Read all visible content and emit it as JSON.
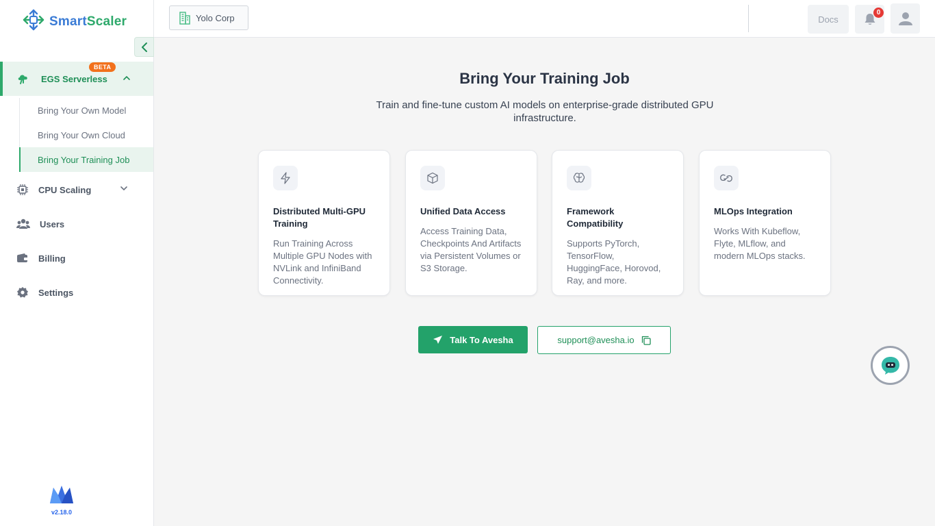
{
  "brand": {
    "name_part1": "Smart",
    "name_part2": "Scaler",
    "primary_color": "#3a7bd5",
    "accent_color": "#2ea96b"
  },
  "sidebar": {
    "egs": {
      "label": "EGS Serverless",
      "badge": "BETA"
    },
    "sub_items": [
      {
        "label": "Bring Your Own Model"
      },
      {
        "label": "Bring Your Own Cloud"
      },
      {
        "label": "Bring Your Training Job",
        "active": true
      }
    ],
    "items": [
      {
        "label": "CPU Scaling",
        "icon": "cpu-icon"
      },
      {
        "label": "Users",
        "icon": "users-icon"
      },
      {
        "label": "Billing",
        "icon": "wallet-icon"
      },
      {
        "label": "Settings",
        "icon": "gear-icon"
      }
    ],
    "version": "v2.18.0"
  },
  "header": {
    "org": "Yolo Corp",
    "docs": "Docs",
    "notification_count": "0"
  },
  "main": {
    "title": "Bring Your Training Job",
    "subtitle": "Train and fine-tune custom AI models on enterprise-grade distributed GPU infrastructure.",
    "cards": [
      {
        "title": "Distributed Multi-GPU Training",
        "desc": "Run Training Across Multiple GPU Nodes with NVLink and InfiniBand Connectivity.",
        "icon": "lightning-icon"
      },
      {
        "title": "Unified Data Access",
        "desc": "Access Training Data, Checkpoints And Artifacts via Persistent Volumes or S3 Storage.",
        "icon": "box-icon"
      },
      {
        "title": "Framework Compatibility",
        "desc": "Supports PyTorch, TensorFlow, HuggingFace, Horovod, Ray, and more.",
        "icon": "brain-icon"
      },
      {
        "title": "MLOps Integration",
        "desc": "Works With Kubeflow, Flyte, MLflow, and modern MLOps stacks.",
        "icon": "link-icon"
      }
    ],
    "talk_button": "Talk To Avesha",
    "support_email": "support@avesha.io"
  }
}
